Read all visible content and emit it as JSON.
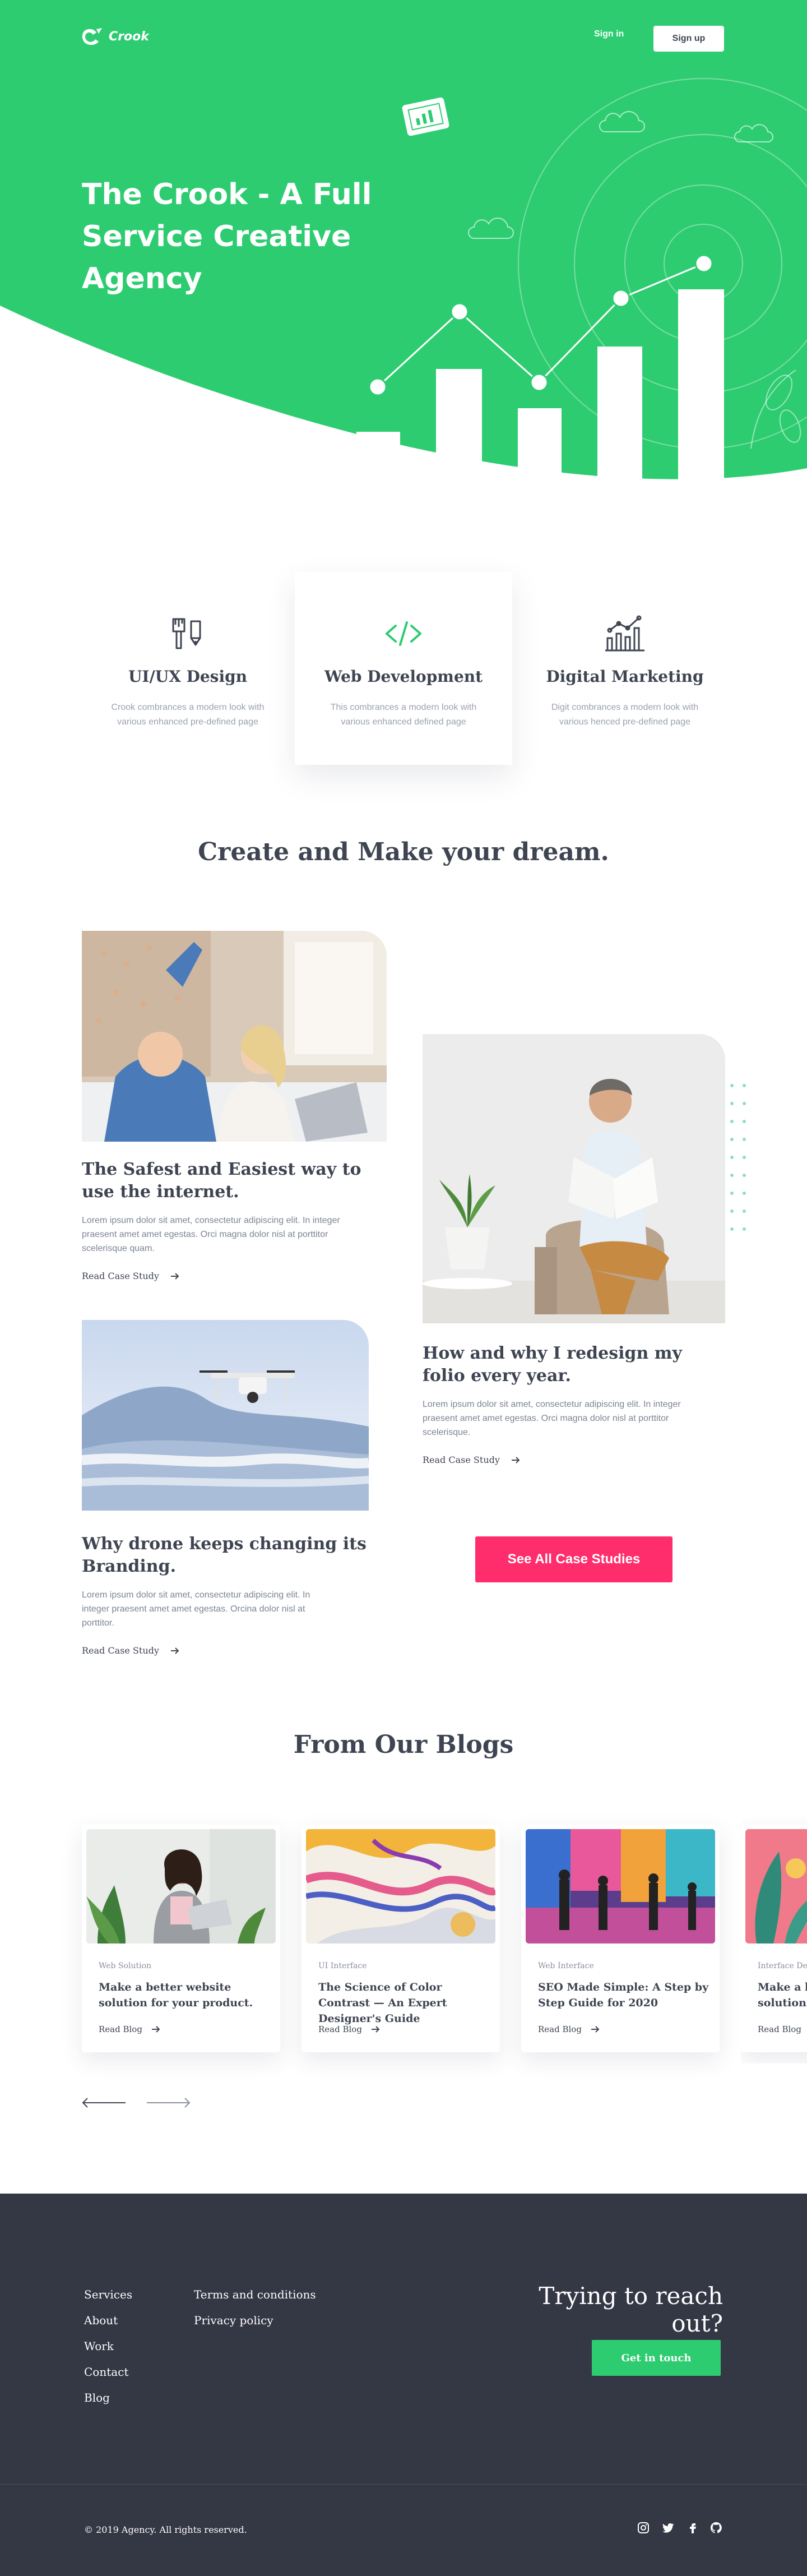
{
  "brand": {
    "name": "Crook",
    "accent": "#2ecc71",
    "cta": "#ff2d6b",
    "dark": "#343744"
  },
  "nav": {
    "signin_label": "Sign in",
    "signup_label": "Sign up"
  },
  "hero": {
    "title": "The Crook - A Full Service Creative Agency",
    "decor_icon": "presentation-chart-icon"
  },
  "services": [
    {
      "icon": "pen-brush-icon",
      "title": "UI/UX Design",
      "desc": "Crook combrances a modern look with various enhanced pre-defined page"
    },
    {
      "icon": "code-icon",
      "title": "Web Development",
      "desc": "This combrances a modern look with various enhanced defined page"
    },
    {
      "icon": "analytics-icon",
      "title": "Digital Marketing",
      "desc": "Digit combrances a modern look with various henced pre-defined page"
    }
  ],
  "cases_section": {
    "title": "Create and Make your dream."
  },
  "cases": [
    {
      "title": "The Safest and Easiest way to use the internet.",
      "text": "Lorem ipsum dolor sit amet, consectetur adipiscing elit. In integer praesent amet amet egestas. Orci magna dolor nisl at porttitor scelerisque quam.",
      "link": "Read Case Study"
    },
    {
      "title": "How and why I redesign my folio every year.",
      "text": "Lorem ipsum dolor sit amet, consectetur adipiscing elit. In integer praesent amet amet egestas. Orci magna dolor nisl at porttitor scelerisque.",
      "link": "Read Case Study"
    },
    {
      "title": "Why drone keeps changing its Branding.",
      "text": "Lorem ipsum dolor sit amet, consectetur adipiscing elit. In integer praesent amet amet egestas. Orcina dolor nisl at porttitor.",
      "link": "Read Case Study"
    }
  ],
  "cases_cta": "See All Case Studies",
  "blogs_section": {
    "title": "From Our Blogs"
  },
  "blogs": [
    {
      "category": "Web Solution",
      "title": "Make a better website solution for your product.",
      "link": "Read Blog"
    },
    {
      "category": "UI Interface",
      "title": "The Science of Color Contrast — An Expert Designer's Guide",
      "link": "Read Blog"
    },
    {
      "category": "Web Interface",
      "title": "SEO Made Simple: A Step by Step Guide for 2020",
      "link": "Read Blog"
    },
    {
      "category": "Interface Design",
      "title": "Make a better website solution for your product.",
      "link": "Read Blog"
    }
  ],
  "footer": {
    "col1": [
      "Services",
      "About",
      "Work",
      "Contact",
      "Blog"
    ],
    "col2": [
      "Terms and conditions",
      "Privacy policy"
    ],
    "cta_title": "Trying to reach out?",
    "cta_button": "Get in touch",
    "copyright": "© 2019 Agency. All rights reserved.",
    "social": [
      "instagram-icon",
      "twitter-icon",
      "facebook-icon",
      "github-icon"
    ]
  }
}
